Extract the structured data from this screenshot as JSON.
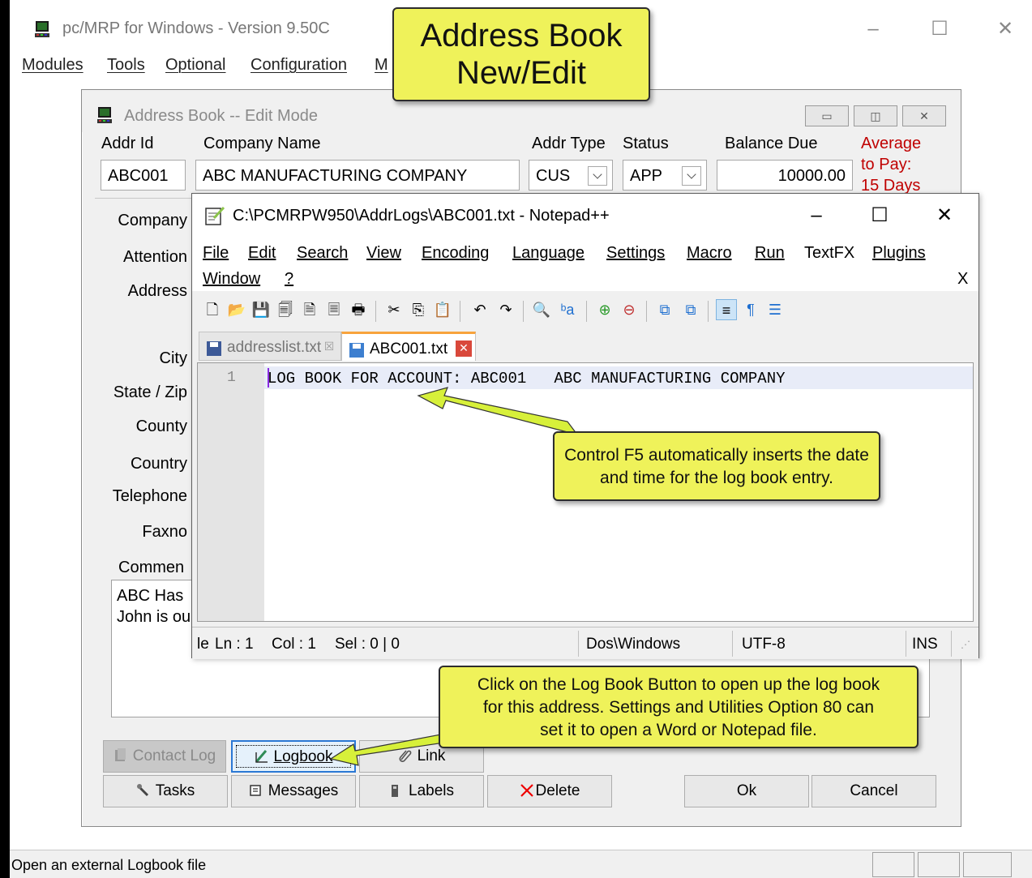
{
  "main_window": {
    "title": "pc/MRP for Windows - Version 9.50C",
    "menu": [
      "Modules",
      "Tools",
      "Optional",
      "Configuration",
      "M"
    ],
    "status_text": "Open an external Logbook file"
  },
  "callouts": {
    "title_line1": "Address Book",
    "title_line2": "New/Edit",
    "ctrl_f5": "Control F5 automatically inserts the date and time for the log book entry.",
    "logbook_line1": "Click on the Log Book Button to open up the log book",
    "logbook_line2": "for this address. Settings and Utilities Option 80 can",
    "logbook_line3": "set it to open a Word or Notepad file."
  },
  "address_book": {
    "title": "Address Book -- Edit Mode",
    "labels": {
      "addr_id": "Addr Id",
      "company_name": "Company Name",
      "addr_type": "Addr Type",
      "status": "Status",
      "balance_due": "Balance Due"
    },
    "values": {
      "addr_id": "ABC001",
      "company_name": "ABC MANUFACTURING COMPANY",
      "addr_type": "CUS",
      "status": "APP",
      "balance_due": "10000.00"
    },
    "average_to_pay": [
      "Average",
      "to Pay:",
      "15 Days"
    ],
    "left_labels": {
      "company": "Company",
      "attention": "Attention",
      "address": "Address",
      "city": "City",
      "state_zip": "State / Zip",
      "county": "County",
      "country": "Country",
      "telephone": "Telephone",
      "faxno": "Faxno",
      "comment": "Commen"
    },
    "comment_lines": [
      "ABC Has",
      "John is ou"
    ],
    "buttons": {
      "contact_log": "Contact Log",
      "logbook": "Logbook",
      "link": "Link",
      "tasks": "Tasks",
      "messages": "Messages",
      "labels": "Labels",
      "delete": "Delete",
      "ok": "Ok",
      "cancel": "Cancel"
    }
  },
  "notepad": {
    "title": "C:\\PCMRPW950\\AddrLogs\\ABC001.txt - Notepad++",
    "menu": [
      "File",
      "Edit",
      "Search",
      "View",
      "Encoding",
      "Language",
      "Settings",
      "Macro",
      "Run",
      "TextFX",
      "Plugins",
      "Window",
      "?"
    ],
    "menu_close": "X",
    "tabs": [
      {
        "label": "addresslist.txt",
        "active": false
      },
      {
        "label": "ABC001.txt",
        "active": true
      }
    ],
    "line_number": "1",
    "line1": "LOG BOOK FOR ACCOUNT: ABC001   ABC MANUFACTURING COMPANY",
    "status": {
      "left": "le",
      "ln": "Ln : 1",
      "col": "Col : 1",
      "sel": "Sel : 0 | 0",
      "eol": "Dos\\Windows",
      "encoding": "UTF-8",
      "mode": "INS"
    }
  },
  "colors": {
    "callout": "#eff25a",
    "arrow": "#d7f03a",
    "red_note": "#c00000",
    "active_tab_accent": "#f8a33c",
    "focus_blue": "#2b78d4"
  }
}
